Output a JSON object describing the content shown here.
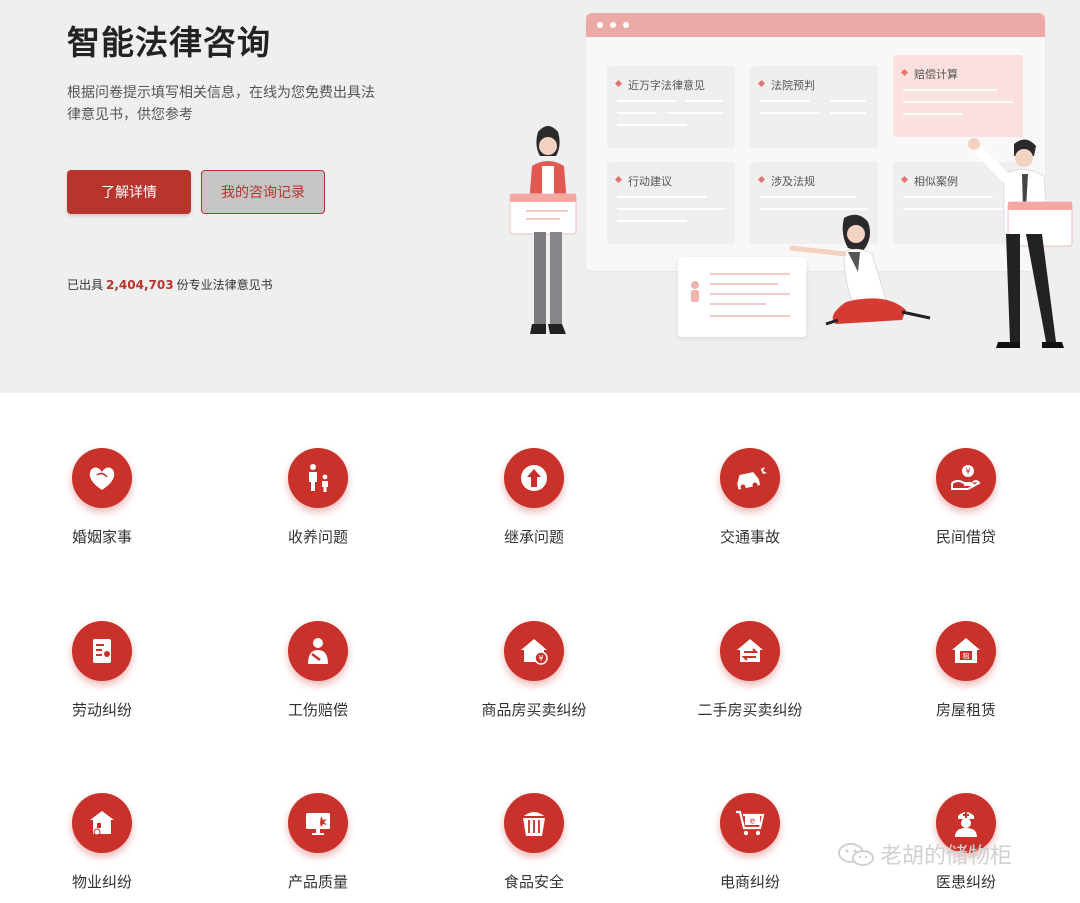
{
  "hero": {
    "title": "智能法律咨询",
    "description": "根据问卷提示填写相关信息，在线为您免费出具法律意见书，供您参考",
    "primary_button": "了解详情",
    "secondary_button": "我的咨询记录",
    "stats_prefix": "已出具",
    "stats_number": "2,404,703",
    "stats_suffix": "份专业法律意见书"
  },
  "illustration": {
    "cards": [
      "近万字法律意见",
      "法院预判",
      "赔偿计算",
      "行动建议",
      "涉及法规",
      "相似案例"
    ]
  },
  "categories": [
    {
      "label": "婚姻家事",
      "icon": "heart-icon"
    },
    {
      "label": "收养问题",
      "icon": "parent-child-icon"
    },
    {
      "label": "继承问题",
      "icon": "inheritance-icon"
    },
    {
      "label": "交通事故",
      "icon": "car-crash-icon"
    },
    {
      "label": "民间借贷",
      "icon": "hand-coin-icon"
    },
    {
      "label": "劳动纠纷",
      "icon": "document-icon"
    },
    {
      "label": "工伤赔偿",
      "icon": "injured-worker-icon"
    },
    {
      "label": "商品房买卖纠纷",
      "icon": "house-yuan-icon"
    },
    {
      "label": "二手房买卖纠纷",
      "icon": "house-exchange-icon"
    },
    {
      "label": "房屋租赁",
      "icon": "house-rent-icon"
    },
    {
      "label": "物业纠纷",
      "icon": "property-icon"
    },
    {
      "label": "产品质量",
      "icon": "monitor-icon"
    },
    {
      "label": "食品安全",
      "icon": "food-box-icon"
    },
    {
      "label": "电商纠纷",
      "icon": "shopping-cart-icon"
    },
    {
      "label": "医患纠纷",
      "icon": "doctor-icon"
    }
  ],
  "watermark": "老胡的储物柜",
  "colors": {
    "brand": "#c8322b",
    "hero_bg": "#efefef",
    "panel_bar": "#eca9a6"
  }
}
